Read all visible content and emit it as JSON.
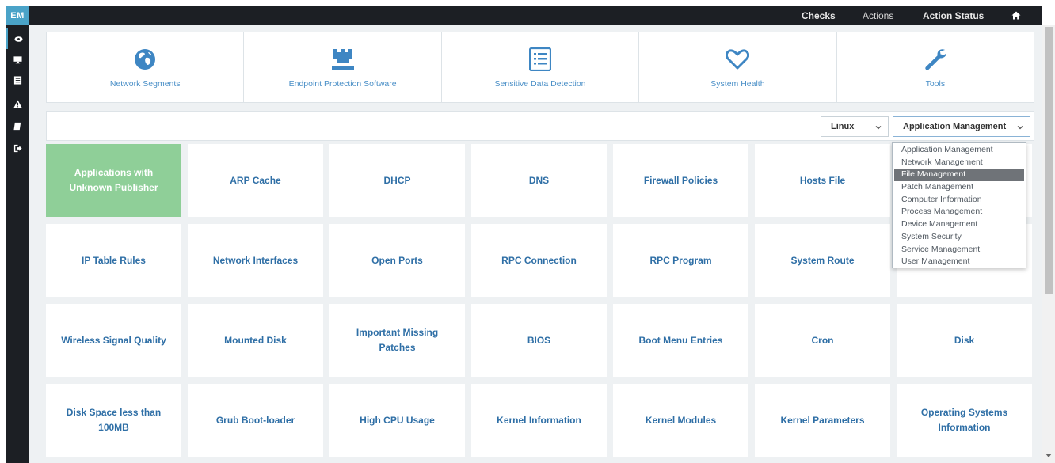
{
  "app": {
    "brand": "EM"
  },
  "topnav": {
    "checks": "Checks",
    "actions": "Actions",
    "action_status": "Action Status",
    "home_icon": "home-icon"
  },
  "sidebar": {
    "icons": [
      "eye-icon",
      "monitor-icon",
      "list-icon",
      "warning-icon",
      "bookmark-icon",
      "logout-icon"
    ]
  },
  "categories": [
    {
      "label": "Network Segments",
      "icon": "globe-icon"
    },
    {
      "label": "Endpoint Protection Software",
      "icon": "castle-icon"
    },
    {
      "label": "Sensitive Data Detection",
      "icon": "list-alt-icon"
    },
    {
      "label": "System Health",
      "icon": "heart-icon"
    },
    {
      "label": "Tools",
      "icon": "wrench-icon"
    }
  ],
  "filters": {
    "os": "Linux",
    "group": "Application Management"
  },
  "dropdown": {
    "options": [
      "Application Management",
      "Network Management",
      "File Management",
      "Patch Management",
      "Computer Information",
      "Process Management",
      "Device Management",
      "System Security",
      "Service Management",
      "User Management"
    ],
    "highlighted": "File Management"
  },
  "tiles": [
    "Applications with Unknown Publisher",
    "ARP Cache",
    "DHCP",
    "DNS",
    "Firewall Policies",
    "Hosts File",
    "",
    "IP Table Rules",
    "Network Interfaces",
    "Open Ports",
    "RPC Connection",
    "RPC Program",
    "System Route",
    "",
    "Wireless Signal Quality",
    "Mounted Disk",
    "Important Missing Patches",
    "BIOS",
    "Boot Menu Entries",
    "Cron",
    "Disk",
    "Disk Space less than 100MB",
    "Grub Boot-loader",
    "High CPU Usage",
    "Kernel Information",
    "Kernel Modules",
    "Kernel Parameters",
    "Operating Systems Information"
  ],
  "active_tile": "Applications with Unknown Publisher",
  "colors": {
    "accent": "#4aa3c8",
    "active_tile": "#8fcf98",
    "link": "#2f6fa6",
    "sidebar": "#1c1f24"
  }
}
